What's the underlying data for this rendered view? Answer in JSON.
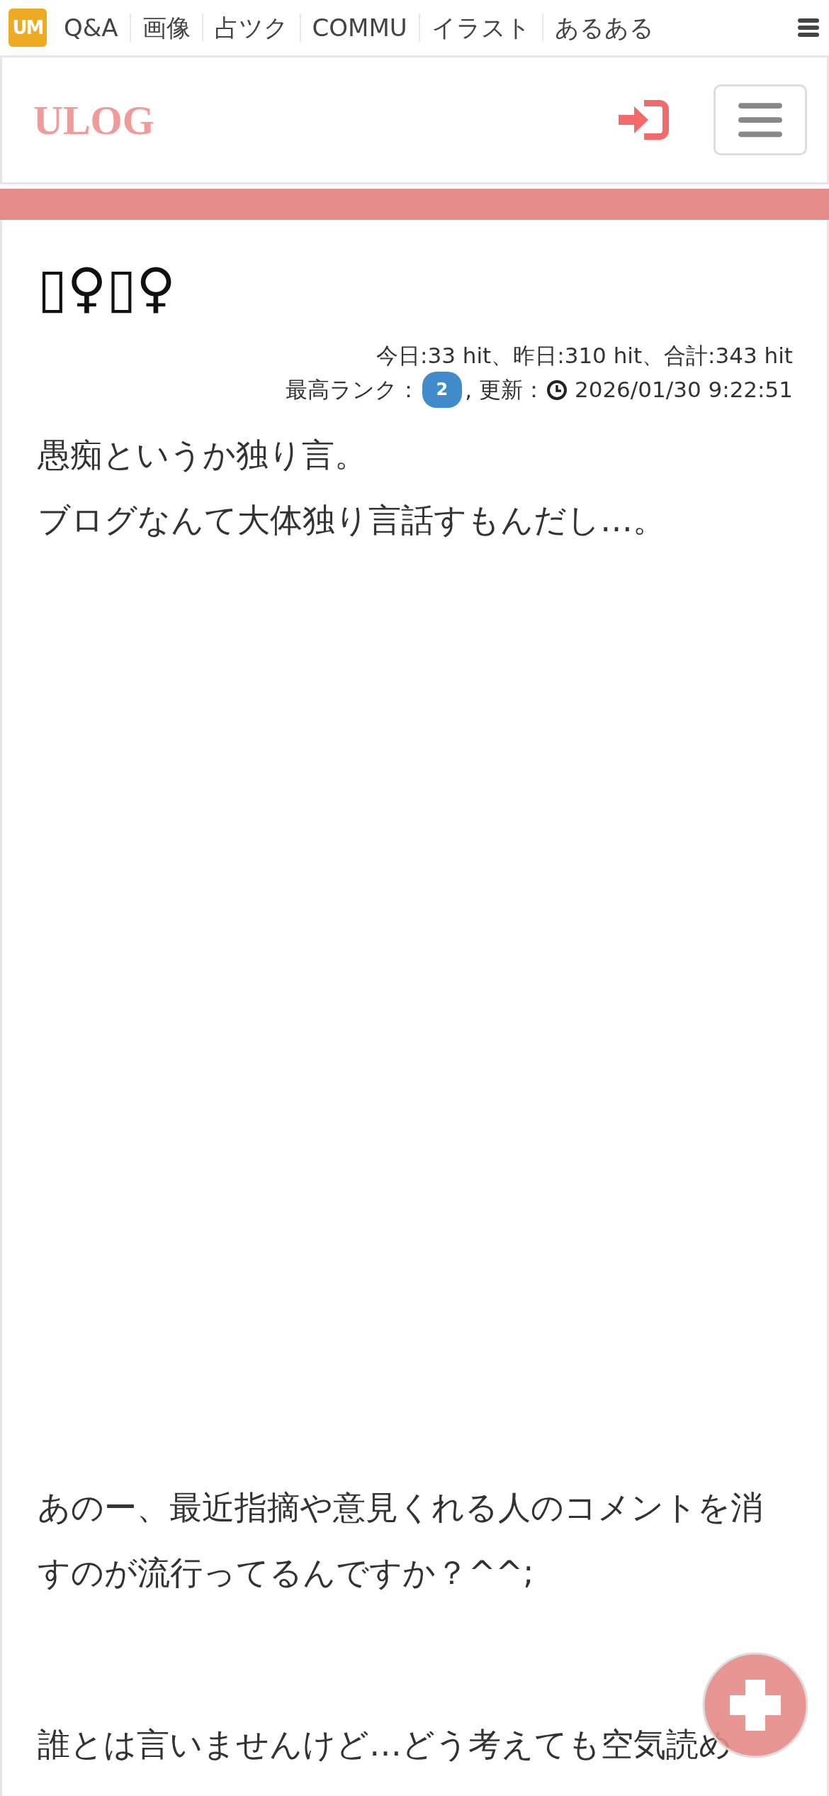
{
  "topbar": {
    "logo": "UM",
    "links": [
      "Q&A",
      "画像",
      "占ツク",
      "COMMU",
      "イラスト",
      "あるある"
    ]
  },
  "header": {
    "brand": "ULOG"
  },
  "article": {
    "title": "▯♀▯♀",
    "stats": "今日:33 hit、昨日:310 hit、合計:343 hit",
    "rank_label": "最高ランク：",
    "rank": "2",
    "updated_label": ", 更新：",
    "updated": "2026/01/30 9:22:51",
    "paragraphs": [
      [
        "愚痴というか独り言。",
        "ブログなんて大体独り言話すもんだし…。"
      ],
      [
        "あのー、最近指摘や意見くれる人のコメントを消すのが流行ってるんですか？^^;"
      ],
      [
        "誰とは言いませんけど…どう考えても空気読め"
      ]
    ]
  }
}
